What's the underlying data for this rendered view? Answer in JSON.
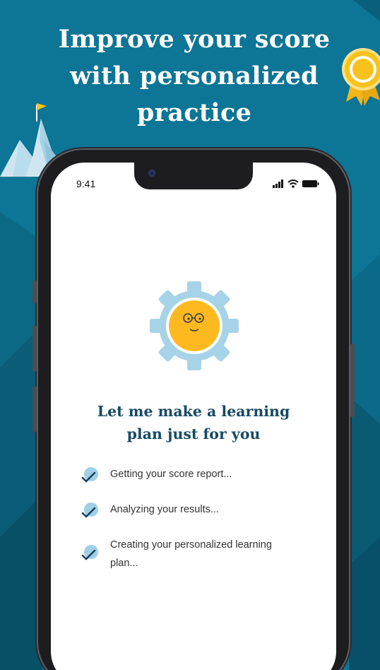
{
  "headline": {
    "line1": "Improve your score",
    "line2": "with personalized",
    "line3": "practice"
  },
  "colors": {
    "background": "#0d7595",
    "title_text": "#174a63",
    "badge_gold": "#f8c21c",
    "gear_blue": "#a7d3e8",
    "face_yellow": "#ffb920",
    "check_blue": "#9fd0e6",
    "check_mark": "#153d5a"
  },
  "phone": {
    "status_time": "9:41",
    "status_icons": [
      "signal-icon",
      "wifi-icon",
      "battery-icon"
    ],
    "mascot": "gear-face-icon",
    "title": {
      "line1": "Let me make a learning",
      "line2": "plan just for you"
    },
    "steps": [
      {
        "label": "Getting your score report..."
      },
      {
        "label": "Analyzing your results..."
      },
      {
        "label_line1": "Creating your personalized learning",
        "label_line2": "plan..."
      }
    ]
  },
  "decorations": [
    "award-badge-icon",
    "mountain-flag-icon"
  ]
}
